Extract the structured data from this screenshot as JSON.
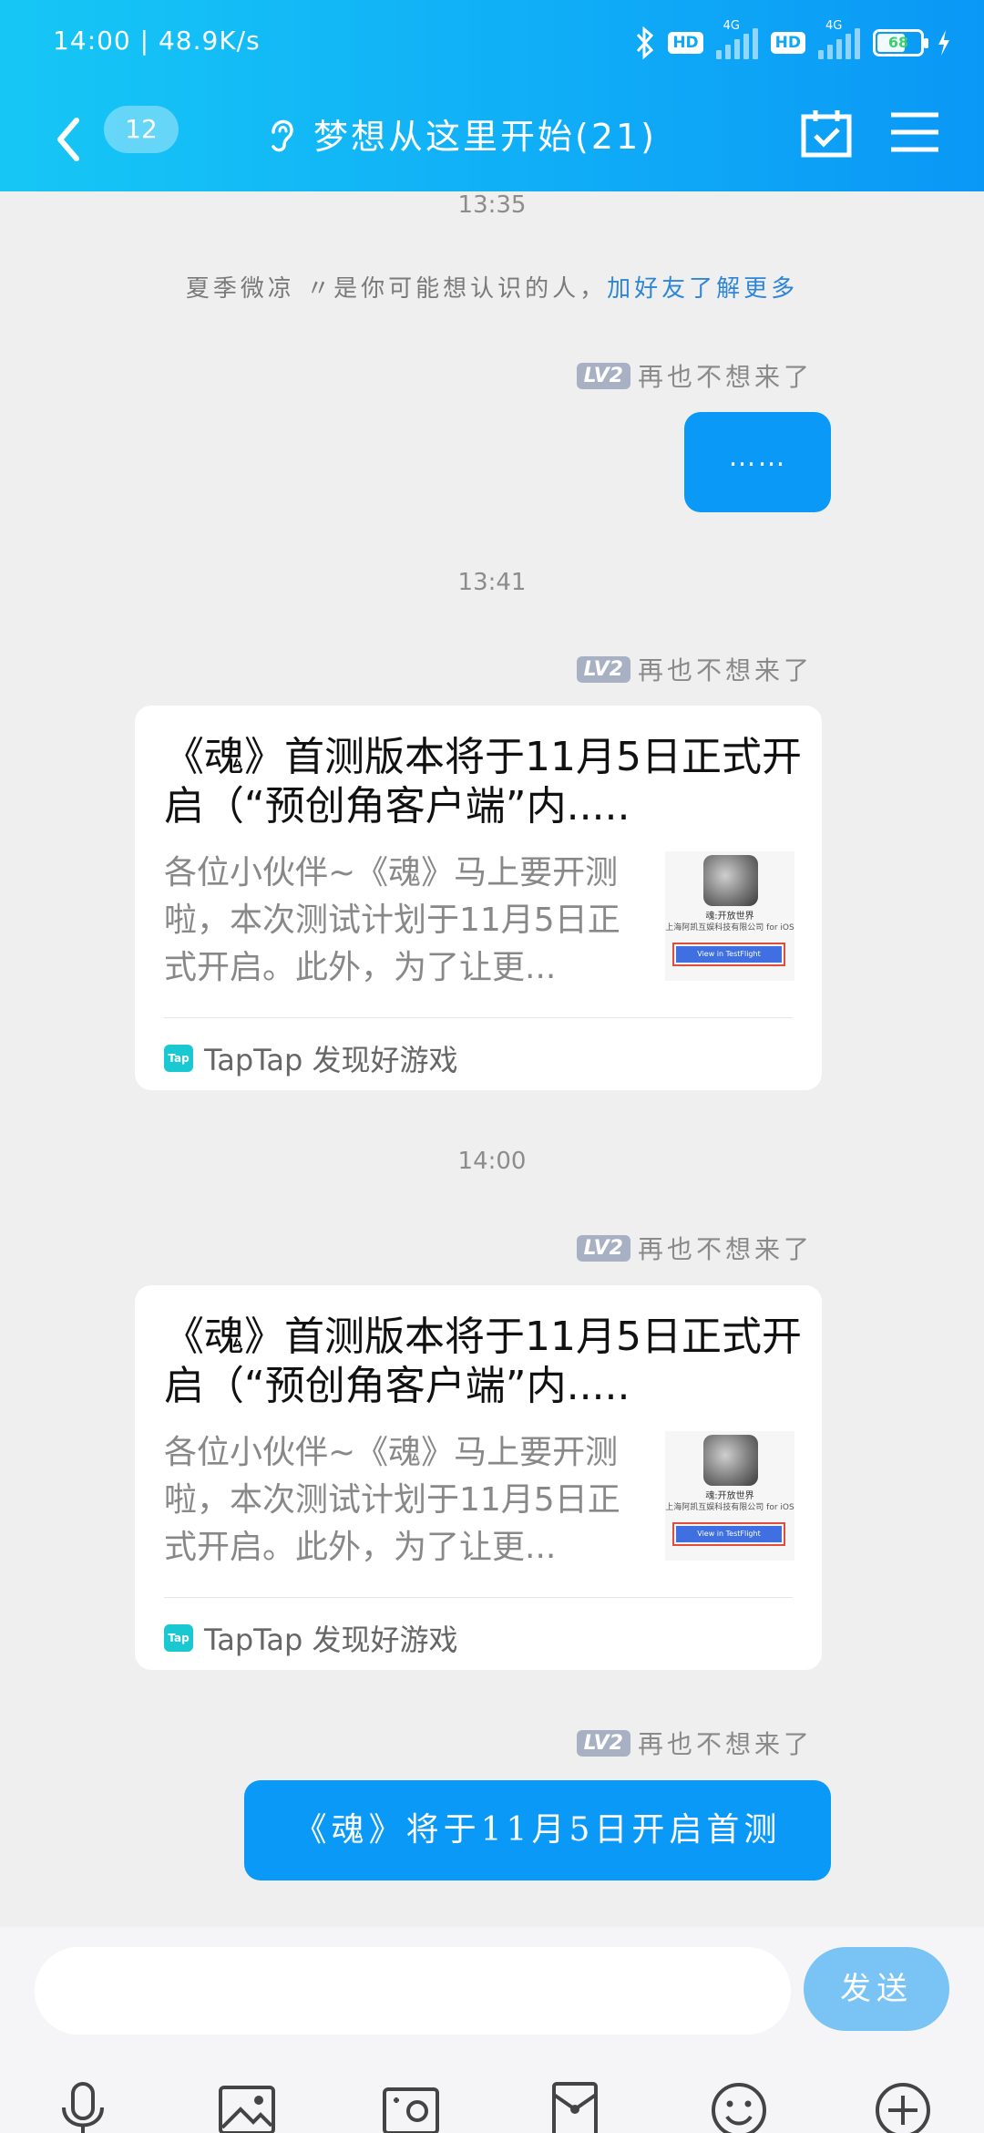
{
  "status_bar": {
    "time": "14:00",
    "speed": "48.9K/s",
    "bluetooth_icon": "bluetooth-icon",
    "hd1": "HD",
    "net1": "4G",
    "hd2": "HD",
    "net2": "4G",
    "battery": "68"
  },
  "header": {
    "back_icon": "chevron-left-icon",
    "unread_count": "12",
    "ear_icon": "ear-icon",
    "title": "梦想从这里开始(21)",
    "calendar_icon": "calendar-check-icon",
    "menu_icon": "menu-icon"
  },
  "messages": {
    "ts1": "13:35",
    "system_text": "夏季微凉 〃是你可能想认识的人，",
    "system_link": "加好友了解更多",
    "sender_level": "LV2",
    "sender_name": "再也不想来了",
    "msg1": "……",
    "ts2": "13:41",
    "card1": {
      "title": "《魂》首测版本将于11月5日正式开启（“预创角客户端”内.....",
      "desc": "各位小伙伴~《魂》马上要开测啦，本次测试计划于11月5日正式开启。此外，为了让更...",
      "thumb_title": "魂:开放世界",
      "thumb_company": "上海阿凯互娱科技有限公司 for iOS",
      "thumb_button": "View in TestFlight",
      "source_logo": "Tap",
      "source": "TapTap 发现好游戏"
    },
    "ts3": "14:00",
    "card2": {
      "title": "《魂》首测版本将于11月5日正式开启（“预创角客户端”内.....",
      "desc": "各位小伙伴~《魂》马上要开测啦，本次测试计划于11月5日正式开启。此外，为了让更...",
      "thumb_title": "魂:开放世界",
      "thumb_company": "上海阿凯互娱科技有限公司 for iOS",
      "thumb_button": "View in TestFlight",
      "source_logo": "Tap",
      "source": "TapTap 发现好游戏"
    },
    "msg_last": "《魂》将于11月5日开启首测"
  },
  "input": {
    "placeholder": "",
    "send_label": "发送",
    "tools": [
      "microphone-icon",
      "image-icon",
      "camera-icon",
      "red-packet-icon",
      "emoji-icon",
      "plus-icon"
    ]
  },
  "colors": {
    "header_start": "#16c7f5",
    "header_end": "#0a98f6",
    "bubble": "#0b99f7",
    "send_button": "#7ac4f5",
    "link": "#2f86d6"
  }
}
